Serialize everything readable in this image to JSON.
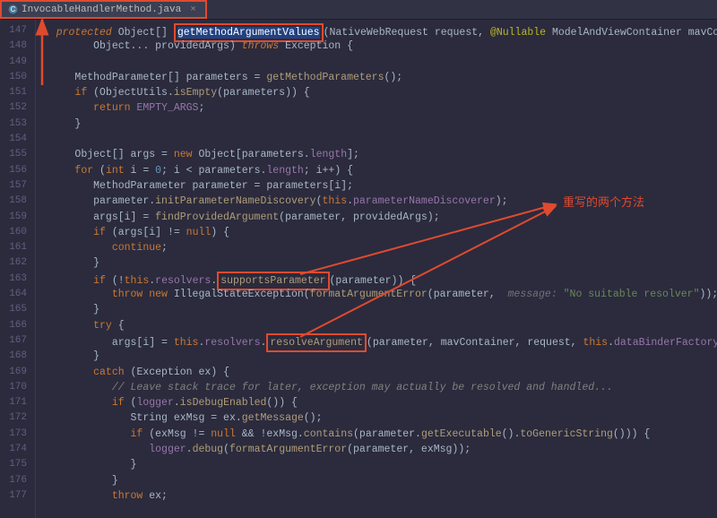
{
  "tab": {
    "filename": "InvocableHandlerMethod.java",
    "icon": "java-class-icon"
  },
  "annotation": {
    "text": "重写的两个方法"
  },
  "highlights": {
    "methodDecl": "getMethodArgumentValues",
    "supports": "supportsParameter",
    "resolve": "resolveArgument"
  },
  "lines": [
    {
      "n": 147,
      "indent": 1,
      "segs": [
        {
          "t": "protected ",
          "c": "kw-i"
        },
        {
          "t": "Object[] ",
          "c": "type"
        },
        {
          "hl": "methodDecl",
          "sel": true,
          "c": "method"
        },
        {
          "t": "(",
          "c": ""
        },
        {
          "t": "NativeWebRequest request, ",
          "c": "param"
        },
        {
          "t": "@Nullable ",
          "c": "ann"
        },
        {
          "t": "ModelAndViewContainer mavContainer,",
          "c": "param"
        }
      ]
    },
    {
      "n": 148,
      "indent": 3,
      "segs": [
        {
          "t": "Object... providedArgs) ",
          "c": "param"
        },
        {
          "t": "throws ",
          "c": "kw-i"
        },
        {
          "t": "Exception {",
          "c": "type"
        }
      ]
    },
    {
      "n": 149,
      "indent": 0,
      "segs": []
    },
    {
      "n": 150,
      "indent": 2,
      "segs": [
        {
          "t": "MethodParameter[] parameters = ",
          "c": "type"
        },
        {
          "t": "getMethodParameters",
          "c": "methodcall"
        },
        {
          "t": "();",
          "c": ""
        }
      ]
    },
    {
      "n": 151,
      "indent": 2,
      "segs": [
        {
          "t": "if ",
          "c": "kw"
        },
        {
          "t": "(ObjectUtils.",
          "c": ""
        },
        {
          "t": "isEmpty",
          "c": "methodcall"
        },
        {
          "t": "(parameters)) {",
          "c": ""
        }
      ]
    },
    {
      "n": 152,
      "indent": 3,
      "segs": [
        {
          "t": "return ",
          "c": "kw"
        },
        {
          "t": "EMPTY_ARGS",
          "c": "field"
        },
        {
          "t": ";",
          "c": ""
        }
      ]
    },
    {
      "n": 153,
      "indent": 2,
      "segs": [
        {
          "t": "}",
          "c": ""
        }
      ]
    },
    {
      "n": 154,
      "indent": 0,
      "segs": []
    },
    {
      "n": 155,
      "indent": 2,
      "segs": [
        {
          "t": "Object[] args = ",
          "c": "type"
        },
        {
          "t": "new ",
          "c": "kw"
        },
        {
          "t": "Object[parameters.",
          "c": "type"
        },
        {
          "t": "length",
          "c": "field"
        },
        {
          "t": "];",
          "c": ""
        }
      ]
    },
    {
      "n": 156,
      "indent": 2,
      "segs": [
        {
          "t": "for ",
          "c": "kw"
        },
        {
          "t": "(",
          "c": ""
        },
        {
          "t": "int ",
          "c": "kw"
        },
        {
          "t": "i = ",
          "c": ""
        },
        {
          "t": "0",
          "c": "num"
        },
        {
          "t": "; i < parameters.",
          "c": ""
        },
        {
          "t": "length",
          "c": "field"
        },
        {
          "t": "; i++) {",
          "c": ""
        }
      ]
    },
    {
      "n": 157,
      "indent": 3,
      "segs": [
        {
          "t": "MethodParameter parameter = parameters[i];",
          "c": "type"
        }
      ]
    },
    {
      "n": 158,
      "indent": 3,
      "segs": [
        {
          "t": "parameter.",
          "c": ""
        },
        {
          "t": "initParameterNameDiscovery",
          "c": "methodcall"
        },
        {
          "t": "(",
          "c": ""
        },
        {
          "t": "this",
          "c": "kw"
        },
        {
          "t": ".",
          "c": ""
        },
        {
          "t": "parameterNameDiscoverer",
          "c": "field"
        },
        {
          "t": ");",
          "c": ""
        }
      ]
    },
    {
      "n": 159,
      "indent": 3,
      "segs": [
        {
          "t": "args[i] = ",
          "c": ""
        },
        {
          "t": "findProvidedArgument",
          "c": "methodcall"
        },
        {
          "t": "(parameter, providedArgs);",
          "c": ""
        }
      ]
    },
    {
      "n": 160,
      "indent": 3,
      "segs": [
        {
          "t": "if ",
          "c": "kw"
        },
        {
          "t": "(args[i] != ",
          "c": ""
        },
        {
          "t": "null",
          "c": "kw"
        },
        {
          "t": ") {",
          "c": ""
        }
      ]
    },
    {
      "n": 161,
      "indent": 4,
      "segs": [
        {
          "t": "continue",
          "c": "kw"
        },
        {
          "t": ";",
          "c": ""
        }
      ]
    },
    {
      "n": 162,
      "indent": 3,
      "segs": [
        {
          "t": "}",
          "c": ""
        }
      ]
    },
    {
      "n": 163,
      "indent": 3,
      "segs": [
        {
          "t": "if ",
          "c": "kw"
        },
        {
          "t": "(!",
          "c": ""
        },
        {
          "t": "this",
          "c": "kw"
        },
        {
          "t": ".",
          "c": ""
        },
        {
          "t": "resolvers",
          "c": "field"
        },
        {
          "t": ".",
          "c": ""
        },
        {
          "hl": "supports",
          "c": "methodcall"
        },
        {
          "t": "(parameter)) {",
          "c": ""
        }
      ]
    },
    {
      "n": 164,
      "indent": 4,
      "segs": [
        {
          "t": "throw new ",
          "c": "kw"
        },
        {
          "t": "IllegalStateException(",
          "c": "type"
        },
        {
          "t": "formatArgumentError",
          "c": "methodcall"
        },
        {
          "t": "(parameter, ",
          "c": ""
        },
        {
          "t": " message: ",
          "c": "paramname"
        },
        {
          "t": "\"No suitable resolver\"",
          "c": "str"
        },
        {
          "t": "));",
          "c": ""
        }
      ]
    },
    {
      "n": 165,
      "indent": 3,
      "segs": [
        {
          "t": "}",
          "c": ""
        }
      ]
    },
    {
      "n": 166,
      "indent": 3,
      "segs": [
        {
          "t": "try ",
          "c": "kw"
        },
        {
          "t": "{",
          "c": ""
        }
      ]
    },
    {
      "n": 167,
      "indent": 4,
      "segs": [
        {
          "t": "args[i] = ",
          "c": ""
        },
        {
          "t": "this",
          "c": "kw"
        },
        {
          "t": ".",
          "c": ""
        },
        {
          "t": "resolvers",
          "c": "field"
        },
        {
          "t": ".",
          "c": ""
        },
        {
          "hl": "resolve",
          "c": "methodcall"
        },
        {
          "t": "(parameter, mavContainer, request, ",
          "c": ""
        },
        {
          "t": "this",
          "c": "kw"
        },
        {
          "t": ".",
          "c": ""
        },
        {
          "t": "dataBinderFactory",
          "c": "field"
        },
        {
          "t": ");",
          "c": ""
        }
      ]
    },
    {
      "n": 168,
      "indent": 3,
      "segs": [
        {
          "t": "}",
          "c": ""
        }
      ]
    },
    {
      "n": 169,
      "indent": 3,
      "segs": [
        {
          "t": "catch ",
          "c": "kw"
        },
        {
          "t": "(Exception ex) {",
          "c": "type"
        }
      ]
    },
    {
      "n": 170,
      "indent": 4,
      "segs": [
        {
          "t": "// Leave stack trace for later, exception may actually be resolved and handled...",
          "c": "comment"
        }
      ]
    },
    {
      "n": 171,
      "indent": 4,
      "segs": [
        {
          "t": "if ",
          "c": "kw"
        },
        {
          "t": "(",
          "c": ""
        },
        {
          "t": "logger",
          "c": "field"
        },
        {
          "t": ".",
          "c": ""
        },
        {
          "t": "isDebugEnabled",
          "c": "methodcall"
        },
        {
          "t": "()) {",
          "c": ""
        }
      ]
    },
    {
      "n": 172,
      "indent": 5,
      "segs": [
        {
          "t": "String exMsg = ex.",
          "c": "type"
        },
        {
          "t": "getMessage",
          "c": "methodcall"
        },
        {
          "t": "();",
          "c": ""
        }
      ]
    },
    {
      "n": 173,
      "indent": 5,
      "segs": [
        {
          "t": "if ",
          "c": "kw"
        },
        {
          "t": "(exMsg != ",
          "c": ""
        },
        {
          "t": "null ",
          "c": "kw"
        },
        {
          "t": "&& !exMsg.",
          "c": ""
        },
        {
          "t": "contains",
          "c": "methodcall"
        },
        {
          "t": "(parameter.",
          "c": ""
        },
        {
          "t": "getExecutable",
          "c": "methodcall"
        },
        {
          "t": "().",
          "c": ""
        },
        {
          "t": "toGenericString",
          "c": "methodcall"
        },
        {
          "t": "())) {",
          "c": ""
        }
      ]
    },
    {
      "n": 174,
      "indent": 6,
      "segs": [
        {
          "t": "logger",
          "c": "field"
        },
        {
          "t": ".",
          "c": ""
        },
        {
          "t": "debug",
          "c": "methodcall"
        },
        {
          "t": "(",
          "c": ""
        },
        {
          "t": "formatArgumentError",
          "c": "methodcall"
        },
        {
          "t": "(parameter, exMsg));",
          "c": ""
        }
      ]
    },
    {
      "n": 175,
      "indent": 5,
      "segs": [
        {
          "t": "}",
          "c": ""
        }
      ]
    },
    {
      "n": 176,
      "indent": 4,
      "segs": [
        {
          "t": "}",
          "c": ""
        }
      ]
    },
    {
      "n": 177,
      "indent": 4,
      "segs": [
        {
          "t": "throw ",
          "c": "kw"
        },
        {
          "t": "ex;",
          "c": ""
        }
      ]
    }
  ]
}
